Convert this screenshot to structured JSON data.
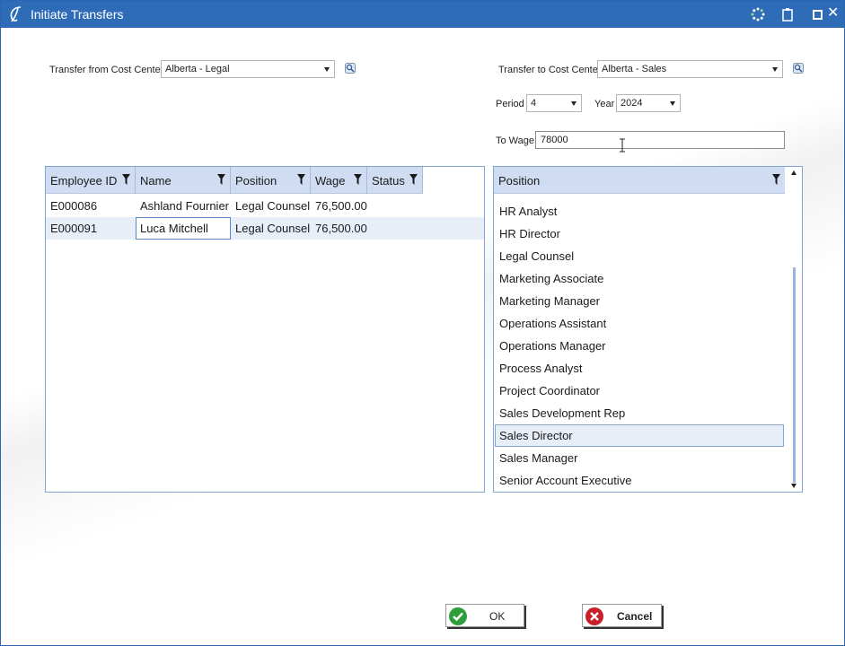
{
  "window": {
    "title": "Initiate Transfers"
  },
  "transfer_from": {
    "label": "Transfer from Cost Center",
    "value": "Alberta - Legal"
  },
  "transfer_to": {
    "label": "Transfer to Cost Center",
    "value": "Alberta - Sales"
  },
  "period": {
    "label": "Period",
    "value": "4"
  },
  "year": {
    "label": "Year",
    "value": "2024"
  },
  "to_wage": {
    "label": "To Wage",
    "value": "78000"
  },
  "employee_grid": {
    "columns": [
      "Employee ID",
      "Name",
      "Position",
      "Wage",
      "Status"
    ],
    "rows": [
      {
        "employee_id": "E000086",
        "name": "Ashland Fournier",
        "position": "Legal Counsel",
        "wage": "76,500.00",
        "status": ""
      },
      {
        "employee_id": "E000091",
        "name": "Luca Mitchell",
        "position": "Legal Counsel",
        "wage": "76,500.00",
        "status": ""
      }
    ]
  },
  "position_list": {
    "header": "Position",
    "items": [
      "HR Analyst",
      "HR Director",
      "Legal Counsel",
      "Marketing Associate",
      "Marketing Manager",
      "Operations Assistant",
      "Operations Manager",
      "Process Analyst",
      "Project Coordinator",
      "Sales Development Rep",
      "Sales Director",
      "Sales Manager",
      "Senior Account Executive"
    ],
    "selected": "Sales Director"
  },
  "buttons": {
    "ok": "OK",
    "cancel": "Cancel"
  },
  "colors": {
    "titlebar": "#2e6cb8",
    "grid_header": "#d0dcf2",
    "ok_green": "#2e9e3a",
    "cancel_red": "#c8202a"
  }
}
